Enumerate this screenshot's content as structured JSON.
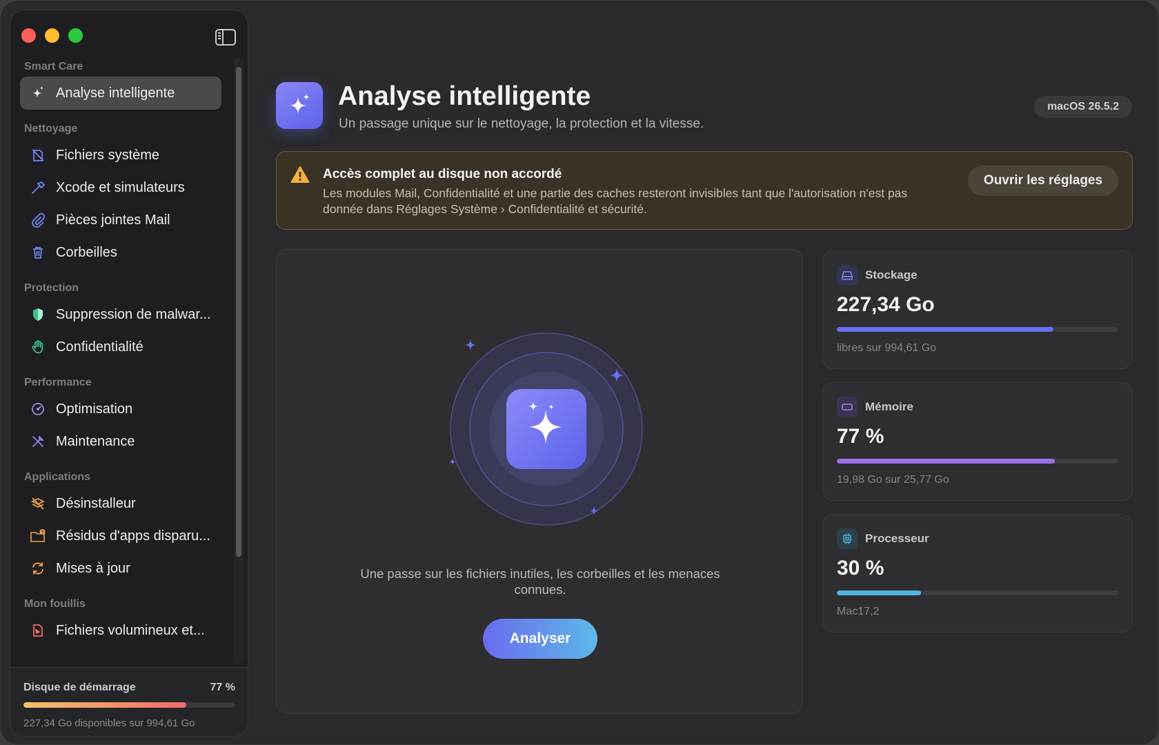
{
  "sidebar": {
    "sections": [
      {
        "label": "Smart Care",
        "items": [
          {
            "label": "Analyse intelligente",
            "icon": "sparkles-icon",
            "active": true
          }
        ]
      },
      {
        "label": "Nettoyage",
        "items": [
          {
            "label": "Fichiers système",
            "icon": "system-files-icon"
          },
          {
            "label": "Xcode et simulateurs",
            "icon": "hammer-icon"
          },
          {
            "label": "Pièces jointes Mail",
            "icon": "paperclip-icon"
          },
          {
            "label": "Corbeilles",
            "icon": "trash-icon"
          }
        ]
      },
      {
        "label": "Protection",
        "items": [
          {
            "label": "Suppression de malwar...",
            "icon": "shield-icon"
          },
          {
            "label": "Confidentialité",
            "icon": "hand-icon"
          }
        ]
      },
      {
        "label": "Performance",
        "items": [
          {
            "label": "Optimisation",
            "icon": "gauge-icon"
          },
          {
            "label": "Maintenance",
            "icon": "tools-icon"
          }
        ]
      },
      {
        "label": "Applications",
        "items": [
          {
            "label": "Désinstalleur",
            "icon": "uninstall-icon"
          },
          {
            "label": "Résidus d'apps disparu...",
            "icon": "folder-question-icon"
          },
          {
            "label": "Mises à jour",
            "icon": "refresh-icon"
          }
        ]
      },
      {
        "label": "Mon fouillis",
        "items": [
          {
            "label": "Fichiers volumineux et...",
            "icon": "large-file-icon"
          }
        ]
      }
    ],
    "disk": {
      "title": "Disque de démarrage",
      "percent_label": "77 %",
      "fill": 0.77,
      "subtitle": "227,34 Go disponibles sur 994,61 Go"
    }
  },
  "header": {
    "title": "Analyse intelligente",
    "subtitle": "Un passage unique sur le nettoyage, la protection et la vitesse.",
    "os_badge": "macOS 26.5.2"
  },
  "warning": {
    "title": "Accès complet au disque non accordé",
    "body": "Les modules Mail, Confidentialité et une partie des caches resteront invisibles tant que l'autorisation n'est pas donnée dans Réglages Système › Confidentialité et sécurité.",
    "button": "Ouvrir les réglages"
  },
  "scan": {
    "description": "Une passe sur les fichiers inutiles, les corbeilles et les menaces connues.",
    "button": "Analyser"
  },
  "stats": [
    {
      "label": "Stockage",
      "value": "227,34 Go",
      "fill": 0.77,
      "subtitle": "libres sur 994,61 Go",
      "color": "#6a6ff0",
      "icon": "drive-icon"
    },
    {
      "label": "Mémoire",
      "value": "77 %",
      "fill": 0.775,
      "subtitle": "19,98 Go sur 25,77 Go",
      "color": "#9b6ee8",
      "icon": "memory-icon"
    },
    {
      "label": "Processeur",
      "value": "30 %",
      "fill": 0.3,
      "subtitle": "Mac17,2",
      "color": "#4fb6de",
      "icon": "cpu-icon"
    }
  ]
}
